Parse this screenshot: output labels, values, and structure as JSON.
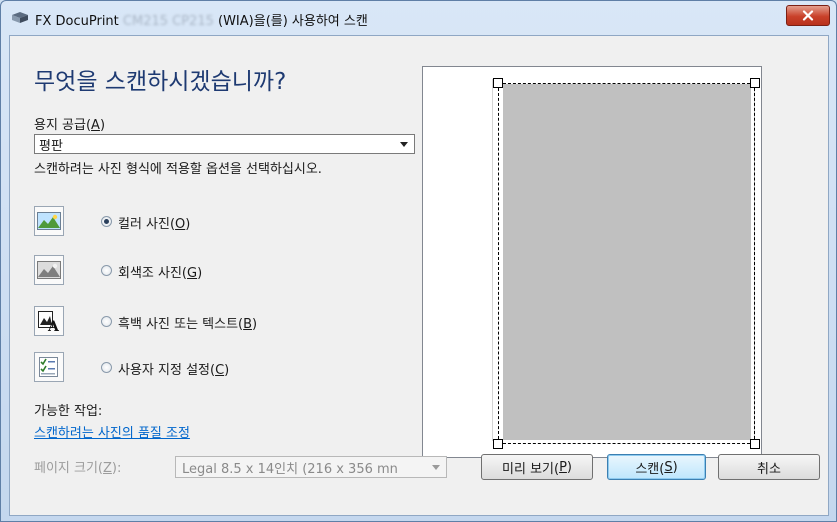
{
  "window": {
    "title_prefix": "FX DocuPrint ",
    "title_blurred": "CM215 CP215",
    "title_suffix": " (WIA)을(를) 사용하여 스캔",
    "close_label": "x"
  },
  "heading": "무엇을 스캔하시겠습니까?",
  "paper_source": {
    "label": "용지 공급(",
    "mnemonic": "A",
    "label_end": ")",
    "value": "평판"
  },
  "instruction": "스캔하려는 사진 형식에 적용할 옵션을 선택하십시오.",
  "options": [
    {
      "label": "컬러 사진(",
      "mnemonic": "O",
      "end": ")",
      "icon": "color-photo-icon",
      "checked": true
    },
    {
      "label": "회색조 사진(",
      "mnemonic": "G",
      "end": ")",
      "icon": "grayscale-photo-icon",
      "checked": false
    },
    {
      "label": "흑백 사진 또는 텍스트(",
      "mnemonic": "B",
      "end": ")",
      "icon": "bw-text-icon",
      "checked": false
    },
    {
      "label": "사용자 지정 설정(",
      "mnemonic": "C",
      "end": ")",
      "icon": "custom-settings-icon",
      "checked": false
    }
  ],
  "tasks": {
    "label": "가능한 작업:",
    "link": "스캔하려는 사진의 품질 조정"
  },
  "page_size": {
    "label": "페이지 크기(",
    "mnemonic": "Z",
    "label_end": "):",
    "value": "Legal 8.5 x 14인치 (216 x 356 mn"
  },
  "buttons": {
    "preview": {
      "label": "미리 보기(",
      "mnemonic": "P",
      "end": ")"
    },
    "scan": {
      "label": "스캔(",
      "mnemonic": "S",
      "end": ")"
    },
    "cancel": {
      "label": "취소"
    }
  }
}
